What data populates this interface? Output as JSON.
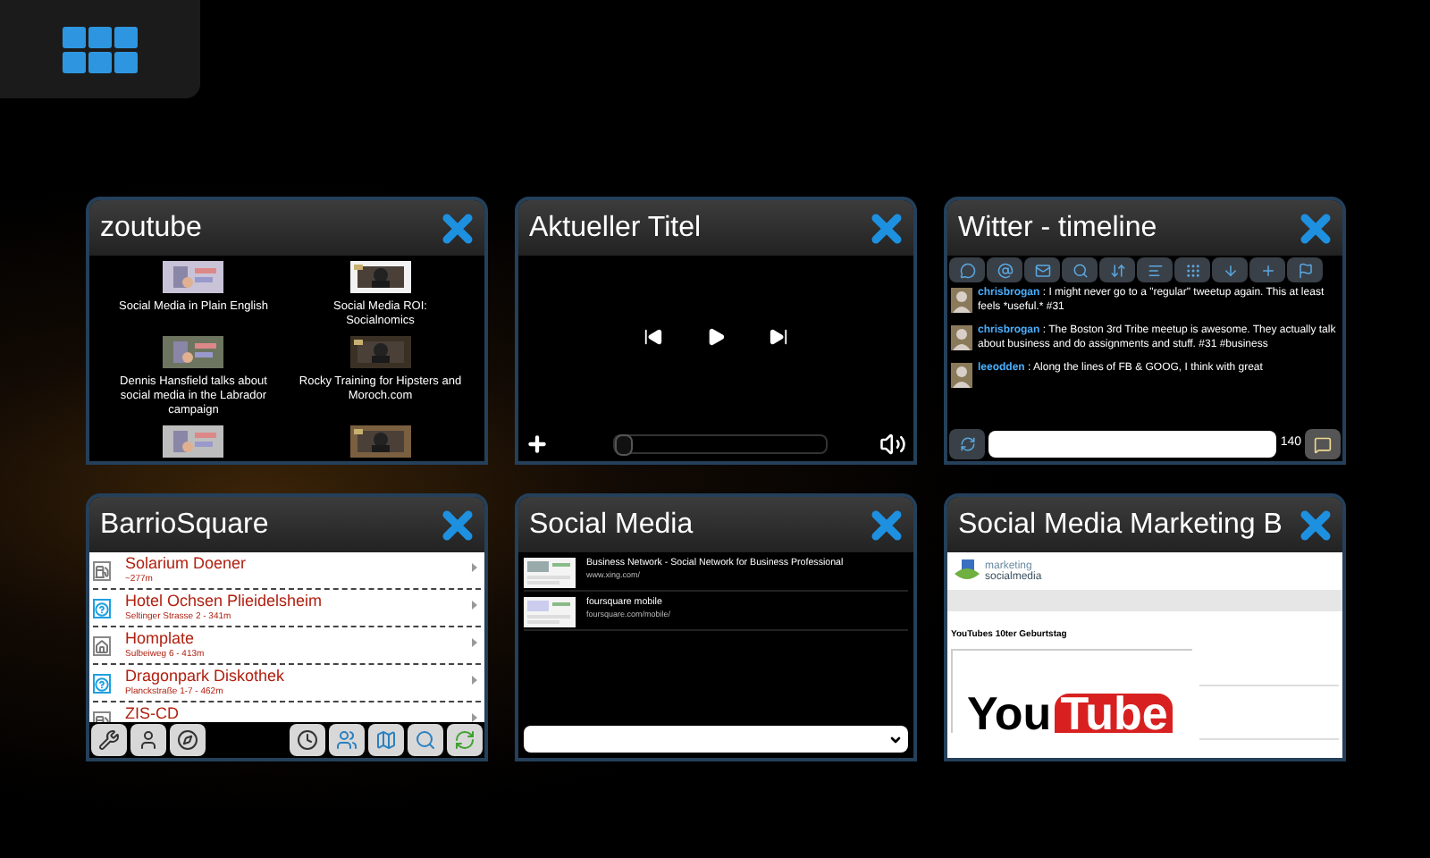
{
  "windows": [
    {
      "kind": "video-list",
      "title": "zoutube",
      "videos": [
        {
          "kind": "captioned",
          "title": "Social Media in Plain English"
        },
        {
          "kind": "captioned",
          "title": "Social Media ROI: Socialnomics"
        },
        {
          "kind": "captioned",
          "title": "Dennis Hansfield talks about social media in the Labrador campaign"
        },
        {
          "kind": "captioned",
          "title": "Rocky Training for Hipsters and Moroch.com"
        },
        {
          "kind": "thumbnail-only"
        },
        {
          "kind": "thumbnail-only"
        }
      ]
    },
    {
      "kind": "media-player",
      "title": "Aktueller Titel",
      "progress": {
        "level": 0
      }
    },
    {
      "kind": "twitter",
      "title": "Witter - timeline",
      "tweets": [
        {
          "author": "chrisbrogan",
          "separator": ":",
          "text": "I might never go to a \"regular\" tweetup again. This at least feels *useful.* #31"
        },
        {
          "author": "chrisbrogan",
          "separator": ":",
          "text": "The Boston 3rd Tribe meetup is awesome. They actually talk about business and do assignments and stuff. #31 #business"
        },
        {
          "author": "leeodden",
          "separator": ":",
          "text": "Along the lines of FB & GOOG, I think with great"
        }
      ],
      "char_count": "140"
    },
    {
      "kind": "places",
      "title": "BarrioSquare",
      "places": [
        {
          "kind": "fuel",
          "name": "Solarium Doener",
          "detail": "~277m"
        },
        {
          "kind": "unknown",
          "name": "Hotel Ochsen Plieidelsheim",
          "detail": "Seltinger Strasse 2 - 341m"
        },
        {
          "kind": "home",
          "name": "Homplate",
          "detail": "Sulbeiweg 6 - 413m"
        },
        {
          "kind": "unknown",
          "name": "Dragonpark Diskothek",
          "detail": "Planckstraße 1-7 - 462m"
        },
        {
          "kind": "fuel",
          "name": "ZIS-CD"
        }
      ]
    },
    {
      "kind": "bookmarks",
      "title": "Social Media",
      "bookmarks": [
        {
          "title": "Business Network - Social Network for Business Professional",
          "url": "www.xing.com/"
        },
        {
          "title": "foursquare mobile",
          "url": "foursquare.com/mobile/"
        }
      ]
    },
    {
      "kind": "webpage",
      "title": "Social Media Marketing B",
      "page": {
        "logo_top": "marketing",
        "logo_bottom": "socialmedia",
        "heading": "YouTubes 10ter Geburtstag",
        "logo_you": "You",
        "logo_tube": "Tube"
      }
    }
  ]
}
